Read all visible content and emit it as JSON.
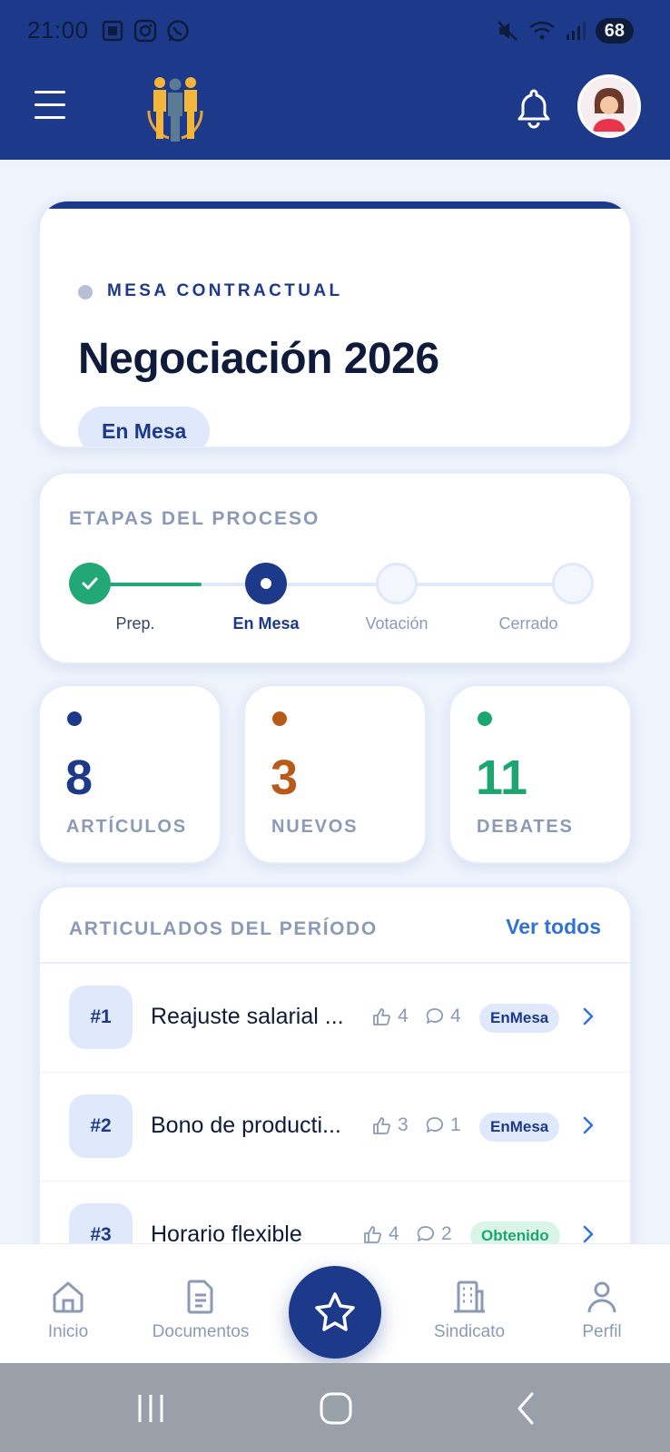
{
  "status_bar": {
    "time": "21:00",
    "battery": "68"
  },
  "hero": {
    "eyebrow": "MESA CONTRACTUAL",
    "title": "Negociación 2026",
    "status_pill": "En Mesa"
  },
  "process": {
    "heading": "ETAPAS DEL PROCESO",
    "steps": [
      {
        "label": "Prep.",
        "state": "done"
      },
      {
        "label": "En Mesa",
        "state": "current"
      },
      {
        "label": "Votación",
        "state": "pending"
      },
      {
        "label": "Cerrado",
        "state": "pending"
      }
    ]
  },
  "stats": [
    {
      "value": "8",
      "label": "ARTÍCULOS",
      "color": "#1d3a8a"
    },
    {
      "value": "3",
      "label": "NUEVOS",
      "color": "#b85a1a"
    },
    {
      "value": "11",
      "label": "DEBATES",
      "color": "#1ea672"
    }
  ],
  "articles": {
    "heading": "ARTICULADOS DEL PERÍODO",
    "see_all": "Ver todos",
    "items": [
      {
        "number": "#1",
        "title": "Reajuste salarial ...",
        "likes": "4",
        "comments": "4",
        "badge": "EnMesa"
      },
      {
        "number": "#2",
        "title": "Bono de producti...",
        "likes": "3",
        "comments": "1",
        "badge": "EnMesa"
      },
      {
        "number": "#3",
        "title": "Horario flexible",
        "likes": "4",
        "comments": "2",
        "badge": "Obtenido"
      }
    ]
  },
  "bottom_nav": {
    "items": [
      {
        "label": "Inicio"
      },
      {
        "label": "Documentos"
      },
      {
        "label": "Sindicato"
      },
      {
        "label": "Perfil"
      }
    ]
  },
  "colors": {
    "primary": "#1d3a8a",
    "accent_blue": "#3272d6",
    "success": "#22a876"
  }
}
